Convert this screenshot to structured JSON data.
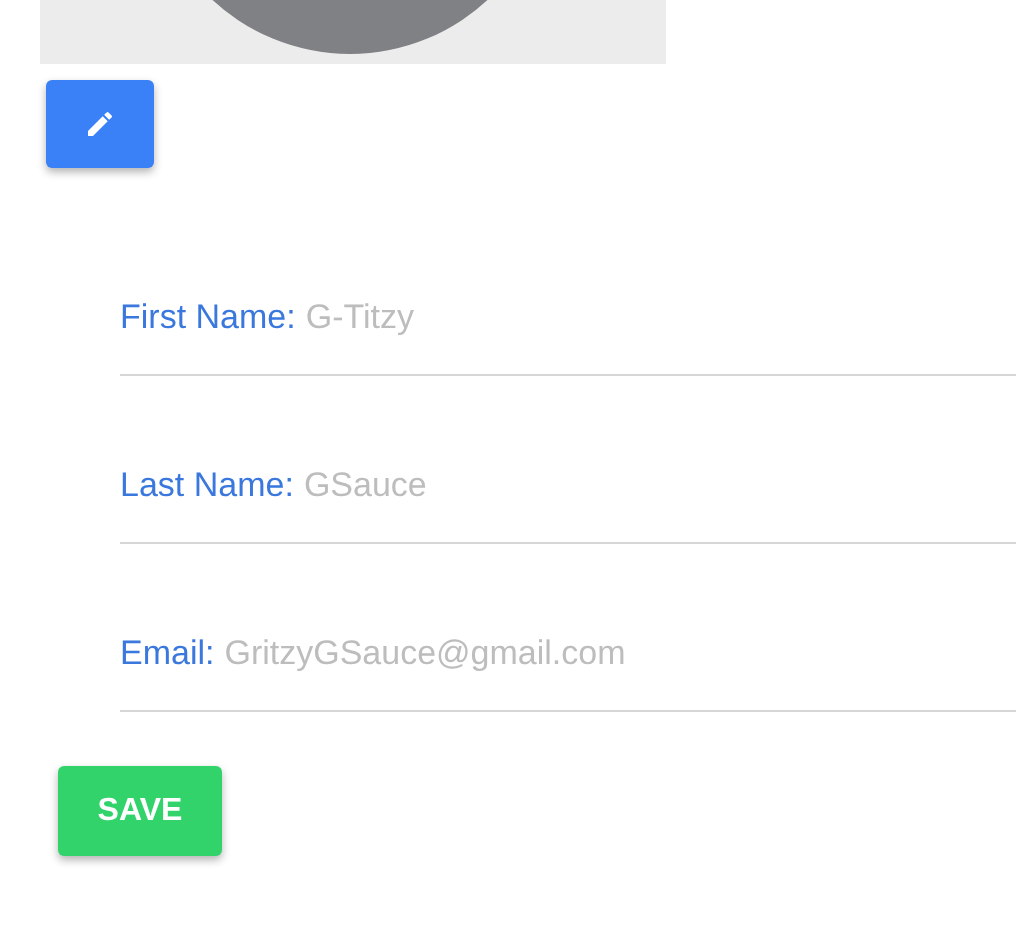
{
  "fields": [
    {
      "label": "First Name:",
      "value": "G-Titzy"
    },
    {
      "label": "Last Name:",
      "value": "GSauce"
    },
    {
      "label": "Email:",
      "value": "GritzyGSauce@gmail.com"
    }
  ],
  "save_button": {
    "label": "SAVE"
  }
}
